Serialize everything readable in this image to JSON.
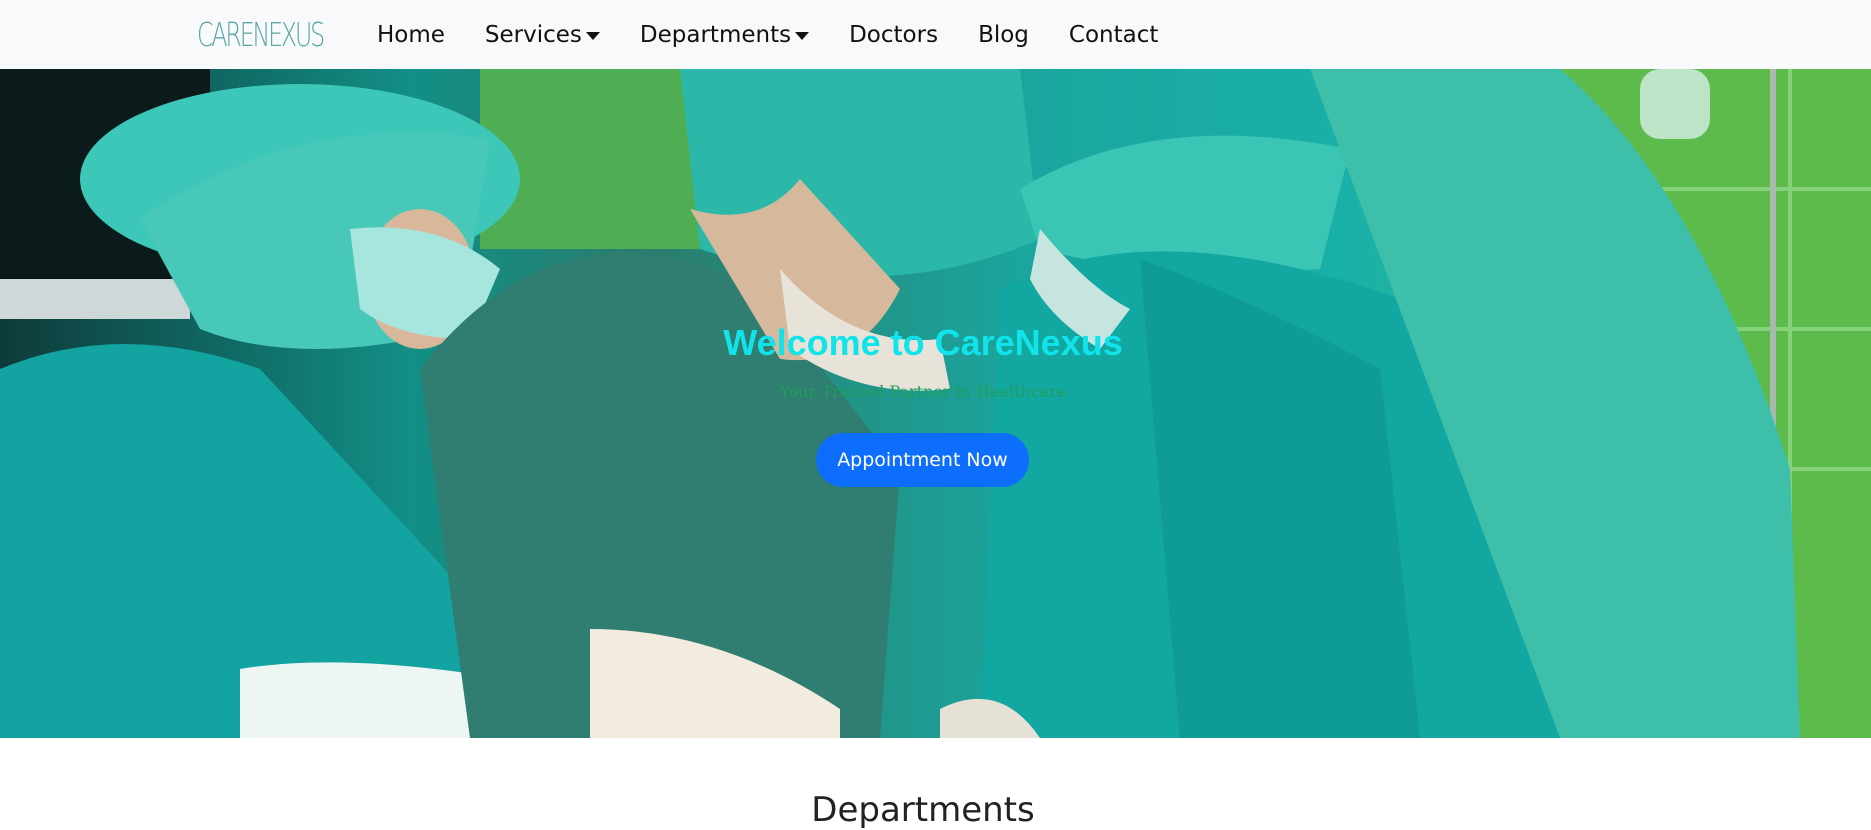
{
  "brand": {
    "logo_text": "CARENEXUS",
    "logo_color": "#5aa6a6"
  },
  "nav": {
    "items": [
      {
        "label": "Home",
        "has_dropdown": false
      },
      {
        "label": "Services",
        "has_dropdown": true
      },
      {
        "label": "Departments",
        "has_dropdown": true
      },
      {
        "label": "Doctors",
        "has_dropdown": false
      },
      {
        "label": "Blog",
        "has_dropdown": false
      },
      {
        "label": "Contact",
        "has_dropdown": false
      }
    ]
  },
  "hero": {
    "title": "Welcome to CareNexus",
    "subtitle": "Your Trusted Partner in Healthcare",
    "cta_label": "Appointment Now",
    "title_color": "#11e3ea",
    "cta_color": "#0d6efd"
  },
  "departments": {
    "heading": "Departments"
  }
}
